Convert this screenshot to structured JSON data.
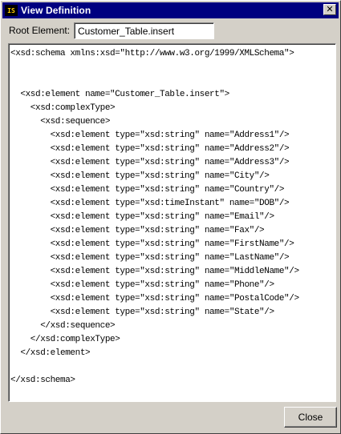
{
  "window": {
    "title": "View Definition",
    "icon": "app-icon",
    "close_glyph": "✕"
  },
  "root_element": {
    "label": "Root Element:",
    "value": "Customer_Table.insert"
  },
  "schema_text": "<xsd:schema xmlns:xsd=\"http://www.w3.org/1999/XMLSchema\">\n\n\n  <xsd:element name=\"Customer_Table.insert\">\n    <xsd:complexType>\n      <xsd:sequence>\n        <xsd:element type=\"xsd:string\" name=\"Address1\"/>\n        <xsd:element type=\"xsd:string\" name=\"Address2\"/>\n        <xsd:element type=\"xsd:string\" name=\"Address3\"/>\n        <xsd:element type=\"xsd:string\" name=\"City\"/>\n        <xsd:element type=\"xsd:string\" name=\"Country\"/>\n        <xsd:element type=\"xsd:timeInstant\" name=\"DOB\"/>\n        <xsd:element type=\"xsd:string\" name=\"Email\"/>\n        <xsd:element type=\"xsd:string\" name=\"Fax\"/>\n        <xsd:element type=\"xsd:string\" name=\"FirstName\"/>\n        <xsd:element type=\"xsd:string\" name=\"LastName\"/>\n        <xsd:element type=\"xsd:string\" name=\"MiddleName\"/>\n        <xsd:element type=\"xsd:string\" name=\"Phone\"/>\n        <xsd:element type=\"xsd:string\" name=\"PostalCode\"/>\n        <xsd:element type=\"xsd:string\" name=\"State\"/>\n      </xsd:sequence>\n    </xsd:complexType>\n  </xsd:element>\n\n</xsd:schema>",
  "buttons": {
    "close_label": "Close"
  },
  "colors": {
    "titlebar": "#000080",
    "face": "#d4d0c8"
  }
}
